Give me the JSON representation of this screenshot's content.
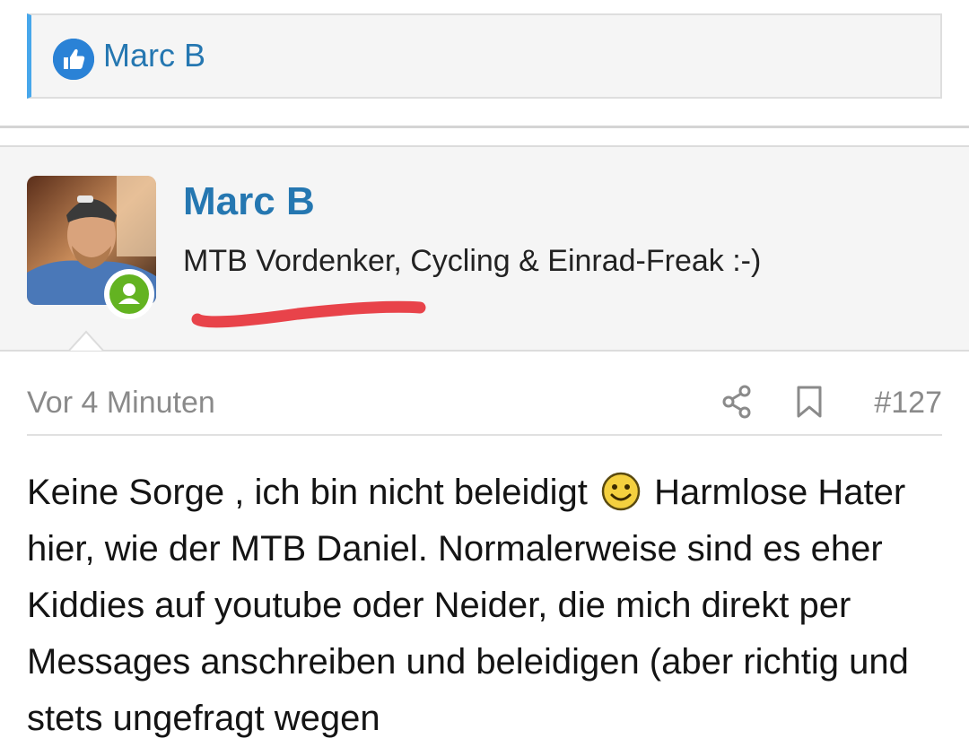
{
  "reactions": {
    "icon": "thumbs-up-icon",
    "name": "Marc B"
  },
  "post": {
    "author": {
      "name": "Marc B",
      "title": "MTB Vordenker, Cycling & Einrad-Freak :-)",
      "status": "online",
      "status_color": "#63b321"
    },
    "time": "Vor 4 Minuten",
    "number": "#127",
    "body": {
      "line1_before_emoji": "Keine Sorge , ich bin nicht beleidigt",
      "emoji": "smiley-icon",
      "line1_after_emoji": "Harmlose",
      "rest": "Hater hier, wie der MTB Daniel. Normalerweise sind es eher Kiddies auf youtube oder Neider, die mich direkt per Messages anschreiben und beleidigen (aber richtig und stets ungefragt wegen"
    }
  },
  "colors": {
    "link_blue": "#2577b1",
    "accent_border": "#47a7eb",
    "annotation_red": "#e8434a"
  }
}
